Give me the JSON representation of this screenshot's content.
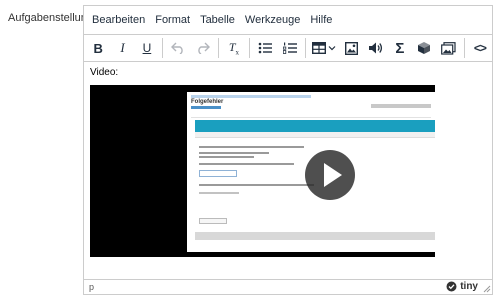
{
  "field": {
    "label": "Aufgabenstellung"
  },
  "menubar": {
    "items": [
      "Bearbeiten",
      "Format",
      "Tabelle",
      "Werkzeuge",
      "Hilfe"
    ]
  },
  "toolbar": {
    "bold": "B",
    "italic": "I",
    "underline": "U",
    "clear_format": "T",
    "clear_format_sub": "x",
    "formula": "Σ",
    "source_code": "<>"
  },
  "content": {
    "paragraph": "Video:"
  },
  "video_frame": {
    "page_title": "Folgefehler"
  },
  "statusbar": {
    "path": "p",
    "brand": "tiny"
  },
  "colors": {
    "border": "#cccccc",
    "icon": "#222f3e",
    "disabled_icon": "#b2b5bb",
    "video_bg": "#000000",
    "frame_accent": "#1a9fbf"
  }
}
